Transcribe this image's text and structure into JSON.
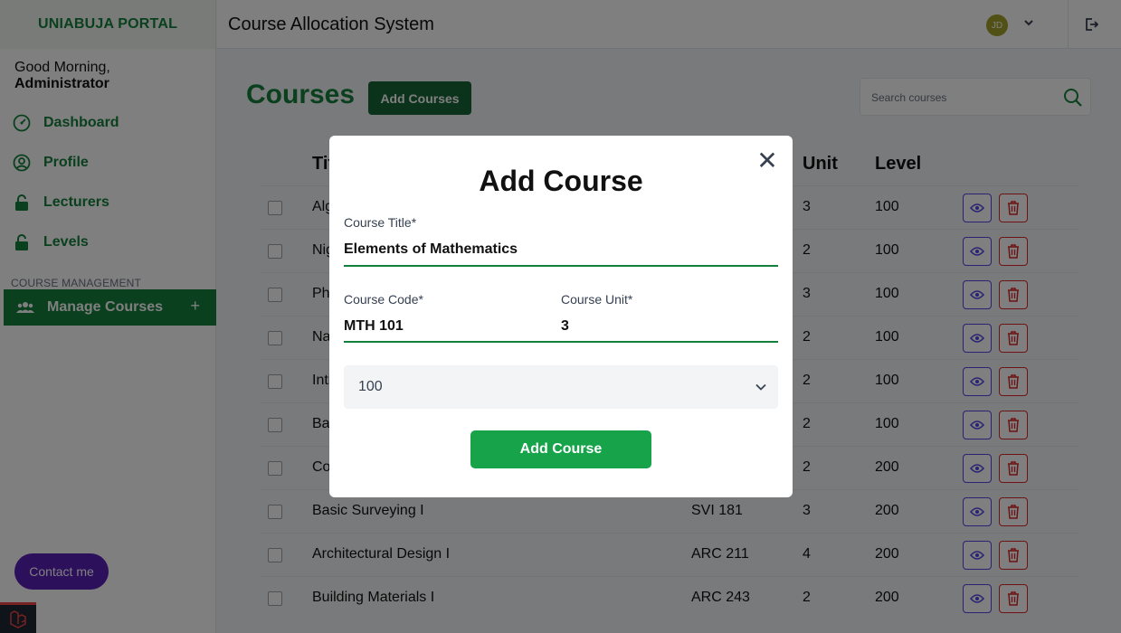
{
  "sidebar": {
    "brand": "UNIABUJA PORTAL",
    "greeting_prefix": "Good Morning,",
    "greeting_name": "Administrator",
    "items": [
      {
        "label": "Dashboard",
        "icon": "dashboard-icon"
      },
      {
        "label": "Profile",
        "icon": "user-circle-icon"
      },
      {
        "label": "Lecturers",
        "icon": "lock-icon"
      },
      {
        "label": "Levels",
        "icon": "lock-icon"
      }
    ],
    "section_label": "COURSE MANAGEMENT",
    "manage_courses": {
      "label": "Manage Courses",
      "icon": "users-icon",
      "expand": "+"
    },
    "contact": "Contact me"
  },
  "header": {
    "title": "Course Allocation System",
    "avatar_initials": "JD"
  },
  "page": {
    "title": "Courses",
    "add_button": "Add Courses",
    "search_placeholder": "Search courses"
  },
  "table": {
    "headers": {
      "title": "Title",
      "unit": "Unit",
      "level": "Level"
    },
    "rows": [
      {
        "title": "Algebra",
        "code": "",
        "unit": "3",
        "level": "100"
      },
      {
        "title": "Nigerian",
        "code": "",
        "unit": "2",
        "level": "100"
      },
      {
        "title": "Physics",
        "code": "",
        "unit": "3",
        "level": "100"
      },
      {
        "title": "Natural",
        "code": "",
        "unit": "2",
        "level": "100"
      },
      {
        "title": "Introduction",
        "code": "",
        "unit": "2",
        "level": "100"
      },
      {
        "title": "Basic",
        "code": "",
        "unit": "2",
        "level": "100"
      },
      {
        "title": "Computer",
        "code": "",
        "unit": "2",
        "level": "200"
      },
      {
        "title": "Basic Surveying I",
        "code": "SVI 181",
        "unit": "3",
        "level": "200"
      },
      {
        "title": "Architectural Design I",
        "code": "ARC 211",
        "unit": "4",
        "level": "200"
      },
      {
        "title": "Building Materials I",
        "code": "ARC 243",
        "unit": "2",
        "level": "200"
      }
    ]
  },
  "modal": {
    "title": "Add Course",
    "close": "✕",
    "course_title_label": "Course Title*",
    "course_title_value": "Elements of Mathematics",
    "course_code_label": "Course Code*",
    "course_code_value": "MTH 101",
    "course_unit_label": "Course Unit*",
    "course_unit_value": "3",
    "level_selected": "100",
    "submit": "Add Course"
  },
  "colors": {
    "brand_green": "#15803d",
    "submit_green": "#16a34a",
    "contact_purple": "#5b21b6",
    "view_blue": "#4f46e5",
    "delete_red": "#dc2626"
  }
}
